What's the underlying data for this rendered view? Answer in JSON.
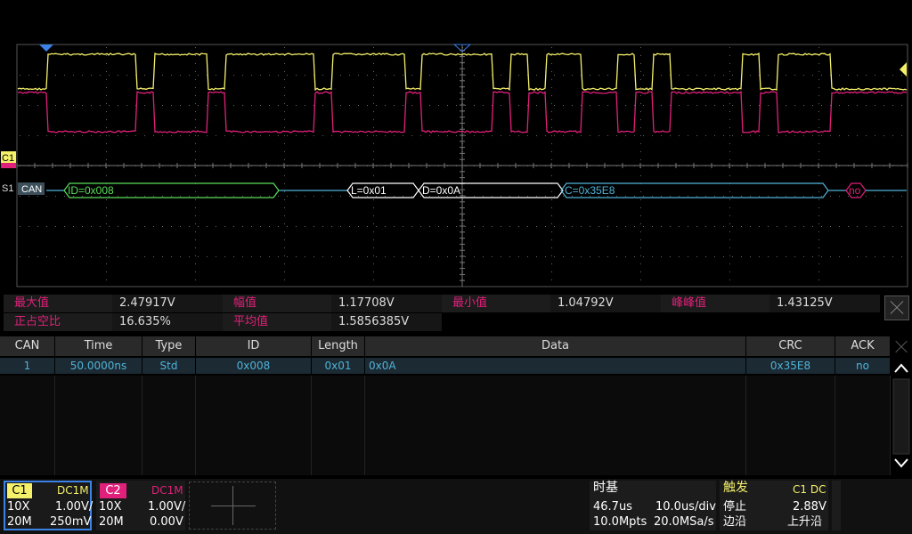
{
  "colors": {
    "ch1": "#f5f06a",
    "ch2": "#e0207a",
    "decode": "#4fb3d9",
    "grid": "#555555"
  },
  "channel_markers": {
    "c1": "C1",
    "s1": "S1",
    "decode_label": "CAN"
  },
  "decode_segments": {
    "id": "ID=0x008",
    "length": "L=0x01",
    "data": "D=0x0A",
    "crc": "C=0x35E8",
    "ack": "no"
  },
  "measurements": {
    "max_label": "最大值",
    "max_value": "2.47917V",
    "amp_label": "幅值",
    "amp_value": "1.17708V",
    "min_label": "最小值",
    "min_value": "1.04792V",
    "pkpk_label": "峰峰值",
    "pkpk_value": "1.43125V",
    "duty_label": "正占空比",
    "duty_value": "16.635%",
    "mean_label": "平均值",
    "mean_value": "1.5856385V"
  },
  "table": {
    "headers": {
      "can": "CAN",
      "time": "Time",
      "type": "Type",
      "id": "ID",
      "length": "Length",
      "data": "Data",
      "crc": "CRC",
      "ack": "ACK"
    },
    "row": {
      "can": "1",
      "time": "50.0000ns",
      "type": "Std",
      "id": "0x008",
      "length": "0x01",
      "data": "0x0A",
      "crc": "0x35E8",
      "ack": "no"
    }
  },
  "ch1": {
    "name": "C1",
    "coupling": "DC1M",
    "probe": "10X",
    "scale": "1.00V/",
    "bw": "20M",
    "offset": "250mV"
  },
  "ch2": {
    "name": "C2",
    "coupling": "DC1M",
    "probe": "10X",
    "scale": "1.00V/",
    "bw": "20M",
    "offset": "0.00V"
  },
  "timebase": {
    "title": "时基",
    "delay": "46.7us",
    "tdiv": "10.0us/div",
    "points": "10.0Mpts",
    "srate": "20.0MSa/s"
  },
  "trigger": {
    "title": "触发",
    "source": "C1 DC",
    "state": "停止",
    "level": "2.88V",
    "type_label": "边沿",
    "slope": "上升沿"
  }
}
